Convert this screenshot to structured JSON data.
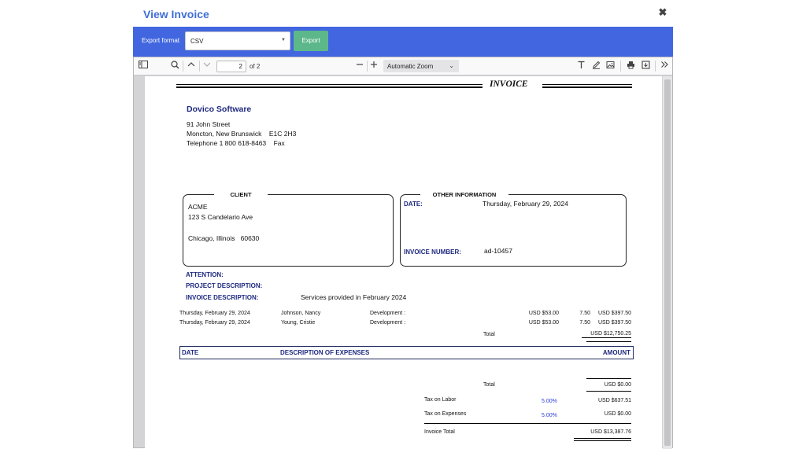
{
  "dialog": {
    "title": "View Invoice",
    "close_icon": "close-icon"
  },
  "export": {
    "label": "Export format",
    "selected": "CSV",
    "button": "Export"
  },
  "pdf_toolbar": {
    "page_current": "2",
    "page_of": "of 2",
    "zoom": "Automatic Zoom"
  },
  "invoice": {
    "heading": "INVOICE",
    "company": {
      "name": "Dovico Software",
      "address1": "91 John Street",
      "address2": "Moncton, New Brunswick    E1C 2H3",
      "phone": "Telephone 1 800 618-8463    Fax"
    },
    "client": {
      "title": "CLIENT",
      "name": "ACME",
      "street": "123 S Candelario Ave",
      "city": "Chicago, Illinois   60630"
    },
    "other": {
      "title": "OTHER INFORMATION",
      "date_label": "DATE:",
      "date_value": "Thursday, February 29, 2024",
      "number_label": "INVOICE NUMBER:",
      "number_value": "ad-10457"
    },
    "attention_label": "ATTENTION:",
    "project_label": "PROJECT DESCRIPTION:",
    "description_label": "INVOICE DESCRIPTION:",
    "description_value": "Services provided in February 2024",
    "labor_rows": [
      {
        "date": "Thursday, February 29, 2024",
        "employee": "Johnson, Nancy",
        "task": "Development :",
        "rate": "USD $53.00",
        "hours": "7.50",
        "amount": "USD $397.50"
      },
      {
        "date": "Thursday, February 29, 2024",
        "employee": "Young, Cristie",
        "task": "Development :",
        "rate": "USD $53.00",
        "hours": "7.50",
        "amount": "USD $397.50"
      }
    ],
    "labor_total_label": "Total",
    "labor_total_value": "USD $12,750.25",
    "expenses_header": {
      "date": "DATE",
      "description": "DESCRIPTION OF EXPENSES",
      "amount": "AMOUNT"
    },
    "expenses_total_label": "Total",
    "expenses_total_value": "USD $0.00",
    "tax_labor_label": "Tax on Labor",
    "tax_labor_rate": "5.00%",
    "tax_labor_value": "USD $637.51",
    "tax_exp_label": "Tax on Expenses",
    "tax_exp_rate": "5.00%",
    "tax_exp_value": "USD $0.00",
    "invoice_total_label": "Invoice Total",
    "invoice_total_value": "USD $13,387.76"
  }
}
